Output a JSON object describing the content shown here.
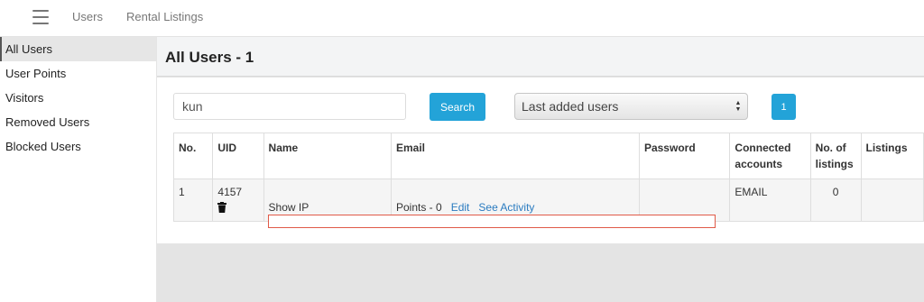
{
  "topbar": {
    "menu_icon": "hamburger-menu-icon",
    "nav": [
      "Users",
      "Rental Listings"
    ]
  },
  "sidebar": {
    "items": [
      {
        "label": "All Users",
        "active": true
      },
      {
        "label": "User Points",
        "active": false
      },
      {
        "label": "Visitors",
        "active": false
      },
      {
        "label": "Removed Users",
        "active": false
      },
      {
        "label": "Blocked Users",
        "active": false
      }
    ]
  },
  "main": {
    "title": "All Users - 1",
    "search": {
      "value": "kun",
      "button_label": "Search"
    },
    "sort_select": {
      "selected": "Last added users"
    },
    "pagination": {
      "current_page": "1"
    },
    "table": {
      "headers": [
        "No.",
        "UID",
        "Name",
        "Email",
        "Password",
        "Connected accounts",
        "No. of listings",
        "Listings"
      ],
      "rows": [
        {
          "no": "1",
          "uid": "4157",
          "delete_icon": "trash-icon",
          "name_action": "Show IP",
          "points": "Points - 0",
          "edit_link": "Edit",
          "activity_link": "See Activity",
          "connected": "EMAIL",
          "listings_count": "0"
        }
      ]
    }
  },
  "colors": {
    "accent": "#23a3d8",
    "highlight_border": "#e05a48",
    "link": "#2a7bc0"
  }
}
